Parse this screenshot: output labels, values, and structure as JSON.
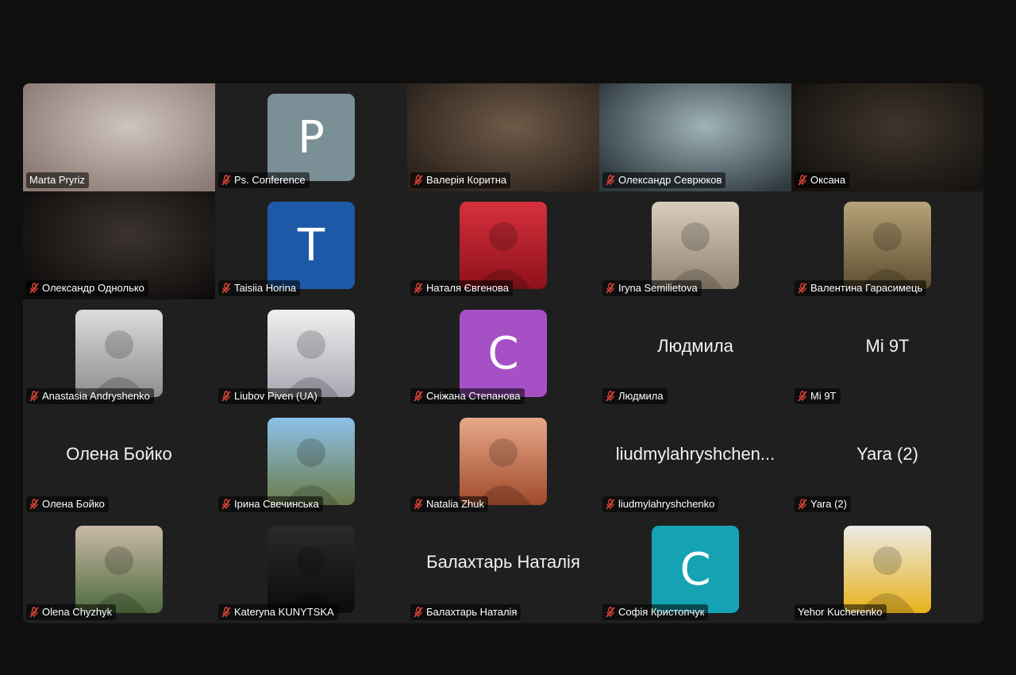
{
  "participants": [
    {
      "name": "Marta Pryriz",
      "label": "Marta Pryriz",
      "type": "video",
      "muted": false,
      "active": true,
      "bg": [
        "#cfc4c0",
        "#8b7a73"
      ]
    },
    {
      "name": "Ps. Conference",
      "label": "Ps. Conference",
      "type": "letter",
      "letter": "P",
      "color": "#7b8f96",
      "muted": true
    },
    {
      "name": "Валерія Коритна",
      "label": "Валерія  Коритна",
      "type": "video",
      "muted": true,
      "bg": [
        "#6e5a48",
        "#2b221c"
      ]
    },
    {
      "name": "Олександр Севрюков",
      "label": "Олександр Севрюков",
      "type": "video",
      "muted": true,
      "bg": [
        "#9fb3b9",
        "#2f3a3f"
      ]
    },
    {
      "name": "Оксана",
      "label": "Оксана",
      "type": "video",
      "muted": true,
      "bg": [
        "#3f352d",
        "#15120f"
      ]
    },
    {
      "name": "Олександр Однолько",
      "label": "Олександр Однолько",
      "type": "video",
      "muted": true,
      "bg": [
        "#3b3330",
        "#0f0d0c"
      ]
    },
    {
      "name": "Taisiia Horina",
      "label": "Taisiia Horina",
      "type": "letter",
      "letter": "T",
      "color": "#1e59a8",
      "muted": true
    },
    {
      "name": "Наталя Євгенова",
      "label": "Наталя Євгенова",
      "type": "photo",
      "bg": [
        "#d6313d",
        "#8d1119"
      ],
      "muted": true
    },
    {
      "name": "Iryna Semilietova",
      "label": "Iryna Semilietova",
      "type": "photo",
      "bg": [
        "#d8cdbd",
        "#8f8270"
      ],
      "muted": true
    },
    {
      "name": "Валентина Гарасимець",
      "label": "Валентина Гарасимець",
      "type": "photo",
      "bg": [
        "#b6a37a",
        "#5d4e2f"
      ],
      "muted": true
    },
    {
      "name": "Anastasia Andryshenko",
      "label": "Anastasia Andryshenko",
      "type": "photo",
      "bg": [
        "#dcdcdc",
        "#8e8e8e"
      ],
      "muted": true
    },
    {
      "name": "Liubov Piven (UA)",
      "label": "Liubov Piven (UA)",
      "type": "photo",
      "bg": [
        "#f0f0f0",
        "#a8a8b4"
      ],
      "muted": true
    },
    {
      "name": "Сніжана Степанова",
      "label": "Сніжана Степанова",
      "type": "letter",
      "letter": "C",
      "color": "#a650c6",
      "muted": true
    },
    {
      "name": "Людмила",
      "label": "Людмила",
      "type": "name",
      "muted": true
    },
    {
      "name": "Mi 9T",
      "label": "Mi 9T",
      "type": "name",
      "muted": true
    },
    {
      "name": "Олена Бойко",
      "label": "Олена Бойко",
      "type": "name",
      "muted": true
    },
    {
      "name": "Ірина Свечинська",
      "label": "Ірина Свечинська",
      "type": "photo",
      "bg": [
        "#8cc1e8",
        "#6b7b4a"
      ],
      "muted": true
    },
    {
      "name": "Natalia Zhuk",
      "label": "Natalia Zhuk",
      "type": "photo",
      "bg": [
        "#e7a98a",
        "#a04a2a"
      ],
      "muted": true
    },
    {
      "name": "liudmylahryshchen...",
      "label": "liudmylahryshchenko",
      "type": "name",
      "muted": true
    },
    {
      "name": "Yara (2)",
      "label": "Yara (2)",
      "type": "name",
      "muted": true
    },
    {
      "name": "Olena Chyzhyk",
      "label": "Olena Chyzhyk",
      "type": "photo",
      "bg": [
        "#c9b9a6",
        "#4e6b3e"
      ],
      "muted": true
    },
    {
      "name": "Kateryna KUNYTSKA",
      "label": "Kateryna KUNYTSKA",
      "type": "photo",
      "bg": [
        "#2a2a2a",
        "#0b0b0b"
      ],
      "muted": true
    },
    {
      "name": "Балахтарь Наталія",
      "label": "Балахтарь Наталія",
      "type": "name",
      "muted": true
    },
    {
      "name": "Софія Кристопчук",
      "label": "Софія Кристопчук",
      "type": "letter",
      "letter": "C",
      "color": "#15a3b3",
      "muted": true
    },
    {
      "name": "Yehor Kucherenko",
      "label": "Yehor Kucherenko",
      "type": "photo",
      "bg": [
        "#ecebe8",
        "#e8b21a"
      ],
      "muted": false
    }
  ],
  "colors": {
    "active_outline": "#36b45a",
    "muted_icon": "#e0463a"
  }
}
